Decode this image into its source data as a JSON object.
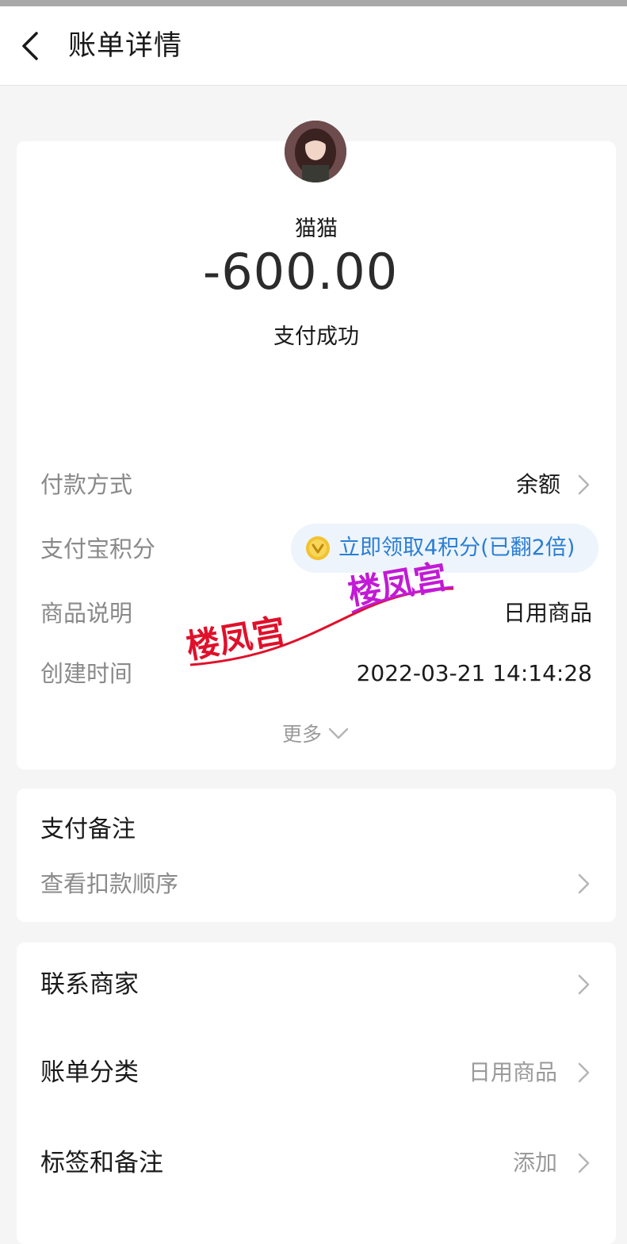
{
  "header": {
    "title": "账单详情"
  },
  "transaction": {
    "payee": "猫猫",
    "amount": "-600.00",
    "status": "支付成功"
  },
  "details": [
    {
      "label": "付款方式",
      "value": "余额"
    },
    {
      "label": "支付宝积分",
      "value": "立即领取4积分(已翻2倍)"
    },
    {
      "label": "商品说明",
      "value": "日用商品"
    },
    {
      "label": "创建时间",
      "value": "2022-03-21 14:14:28"
    }
  ],
  "more_label": "更多",
  "remark": {
    "title": "支付备注",
    "link_label": "查看扣款顺序"
  },
  "links": [
    {
      "label": "联系商家",
      "value": ""
    },
    {
      "label": "账单分类",
      "value": "日用商品"
    },
    {
      "label": "标签和备注",
      "value": "添加"
    }
  ],
  "watermark": {
    "text_a": "楼凤宫",
    "text_b": "楼凤宫"
  },
  "colors": {
    "accent_blue": "#2a7fd4",
    "points_bg": "#eef4fb",
    "coin_gold": "#f2c230",
    "watermark_red": "#e0102a",
    "watermark_purple": "#c21ad6"
  }
}
